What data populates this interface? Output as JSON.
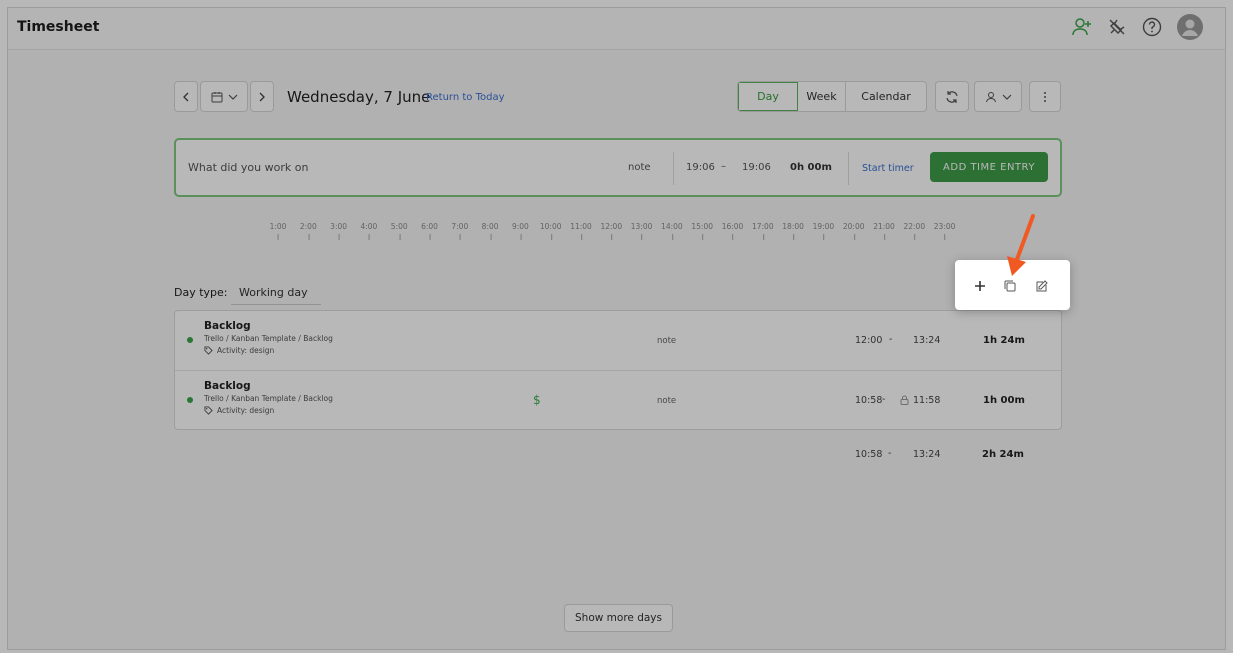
{
  "header": {
    "title": "Timesheet",
    "icons": [
      "add-user-icon",
      "plug-off-icon",
      "help-icon",
      "avatar"
    ]
  },
  "toolbar": {
    "prev_icon": "chevron-left-icon",
    "calendar_icon": "calendar-icon",
    "next_icon": "chevron-right-icon",
    "date": "Wednesday, 7 June",
    "return_link": "Return to Today",
    "views": [
      "Day",
      "Week",
      "Calendar"
    ],
    "active_view": "Day"
  },
  "entry": {
    "placeholder": "What did you work on",
    "note": "note",
    "start": "19:06",
    "dash": "–",
    "end": "19:06",
    "duration": "0h 00m",
    "start_timer": "Start timer",
    "add_button": "ADD TIME ENTRY"
  },
  "timeline": {
    "ticks": [
      "1:00",
      "2:00",
      "3:00",
      "4:00",
      "5:00",
      "6:00",
      "7:00",
      "8:00",
      "9:00",
      "10:00",
      "11:00",
      "12:00",
      "13:00",
      "14:00",
      "15:00",
      "16:00",
      "17:00",
      "18:00",
      "19:00",
      "20:00",
      "21:00",
      "22:00",
      "23:00"
    ]
  },
  "day_type": {
    "label": "Day type:",
    "value": "Working day"
  },
  "entries": [
    {
      "name": "Backlog",
      "path": "Trello / Kanban Template / Backlog",
      "activity": "Activity: design",
      "billable": "",
      "note": "note",
      "start": "12:00",
      "dash": "-",
      "end": "13:24",
      "duration": "1h 24m"
    },
    {
      "name": "Backlog",
      "path": "Trello / Kanban Template / Backlog",
      "activity": "Activity: design",
      "billable": "$",
      "note": "note",
      "start": "10:58",
      "dash": "-",
      "end": "11:58",
      "duration": "1h 00m"
    }
  ],
  "totals": {
    "start": "10:58",
    "dash": "-",
    "end": "13:24",
    "duration": "2h 24m"
  },
  "show_more": "Show more days",
  "popup_actions": [
    "plus-icon",
    "duplicate-icon",
    "edit-icon"
  ],
  "colors": {
    "accent_green": "#3d9c47",
    "link_blue": "#3a6fd1",
    "arrow_orange": "#f05a22"
  }
}
